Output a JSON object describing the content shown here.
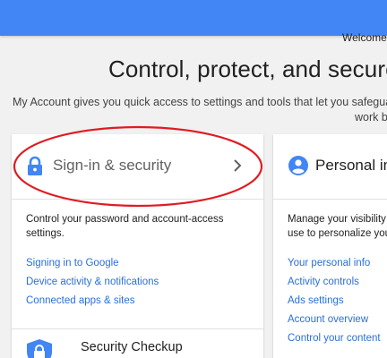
{
  "topbar": {
    "color": "#4285f4"
  },
  "welcome": "Welcome,",
  "hero": {
    "title": "Control, protect, and secure",
    "line1": "My Account gives you quick access to settings and tools that let you safeguard yo",
    "line2": "work be"
  },
  "signin_card": {
    "title": "Sign-in & security",
    "icon": "lock-icon",
    "description": "Control your password and account-access settings.",
    "links": [
      "Signing in to Google",
      "Device activity & notifications",
      "Connected apps & sites"
    ],
    "checkup_title": "Security Checkup"
  },
  "personal_card": {
    "title": "Personal in",
    "icon": "person-icon",
    "description_line1": "Manage your visibility",
    "description_line2": "use to personalize you",
    "links": [
      "Your personal info",
      "Activity controls",
      "Ads settings",
      "Account overview",
      "Control your content"
    ]
  },
  "colors": {
    "accent": "#4285f4",
    "link": "#2a6fd8",
    "annotation": "#e01b22"
  }
}
